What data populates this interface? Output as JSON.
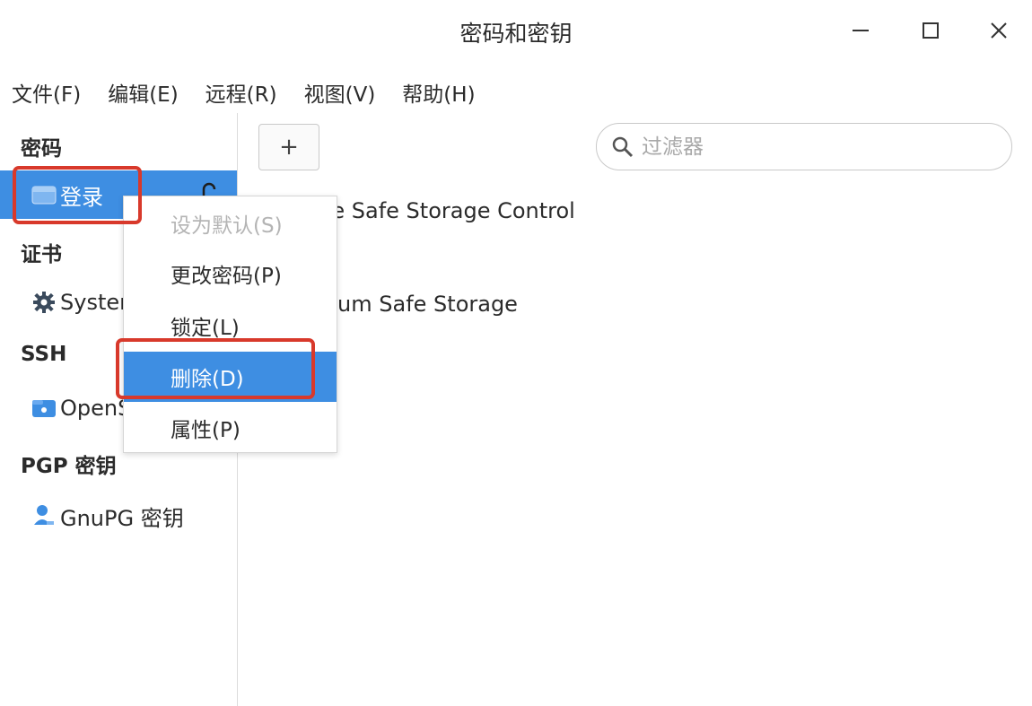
{
  "window": {
    "title": "密码和密钥"
  },
  "menubar": [
    {
      "label": "文件(F)"
    },
    {
      "label": "编辑(E)"
    },
    {
      "label": "远程(R)"
    },
    {
      "label": "视图(V)"
    },
    {
      "label": "帮助(H)"
    }
  ],
  "sidebar": {
    "sections": [
      {
        "heading": "密码",
        "items": [
          {
            "label": "登录",
            "icon": "keyring-folder-icon",
            "selected": true,
            "badge": "lock-open-icon"
          }
        ]
      },
      {
        "heading": "证书",
        "items": [
          {
            "label": "System",
            "icon": "gear-icon"
          }
        ]
      },
      {
        "heading": "SSH",
        "items": [
          {
            "label": "OpenSSH",
            "icon": "ssh-folder-icon"
          }
        ]
      },
      {
        "heading": "PGP 密钥",
        "items": [
          {
            "label": "GnuPG 密钥",
            "icon": "person-key-icon"
          }
        ]
      }
    ]
  },
  "toolbar": {
    "add_label": "+"
  },
  "search": {
    "placeholder": "过滤器",
    "value": ""
  },
  "entries": [
    {
      "label": "Chrome Safe Storage Control"
    },
    {
      "label": "Chromium Safe Storage"
    }
  ],
  "context_menu": {
    "items": [
      {
        "label": "设为默认(S)",
        "disabled": true
      },
      {
        "label": "更改密码(P)"
      },
      {
        "label": "锁定(L)"
      },
      {
        "label": "删除(D)",
        "highlighted": true
      },
      {
        "label": "属性(P)"
      }
    ]
  },
  "colors": {
    "accent": "#3e8ee2",
    "annotation": "#d8392b"
  }
}
